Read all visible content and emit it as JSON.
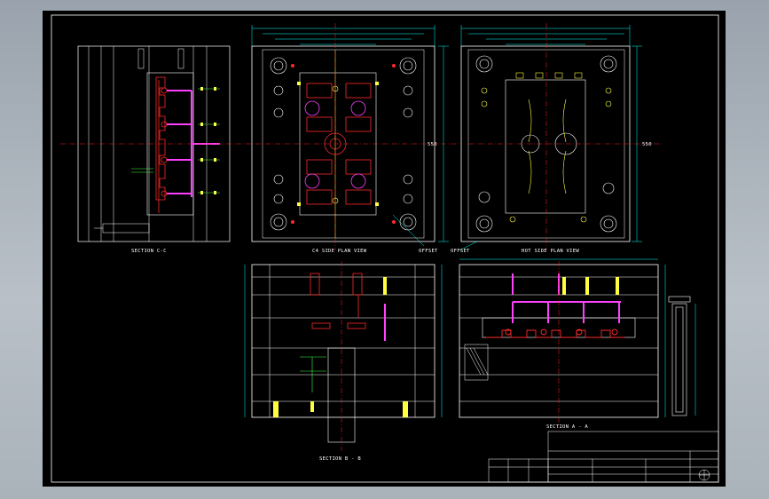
{
  "views": {
    "section_c": "SECTION C-C",
    "cold_plan": "C4 SIDE PLAN VIEW",
    "hot_plan": "HOT SIDE PLAN VIEW",
    "section_b": "SECTION B - B",
    "section_a": "SECTION A - A",
    "offset_left": "OFFSET",
    "offset_right": "OFFSET"
  },
  "dims": {
    "plan_left": "550",
    "plan_right": "550"
  },
  "colors": {
    "frame": "#ffffff",
    "centerline": "#ff2020",
    "dimension": "#00ffff",
    "part": "#ff2a2a",
    "runner": "#ff40ff",
    "cooling": "#40ff40",
    "hardware": "#ffff40"
  }
}
